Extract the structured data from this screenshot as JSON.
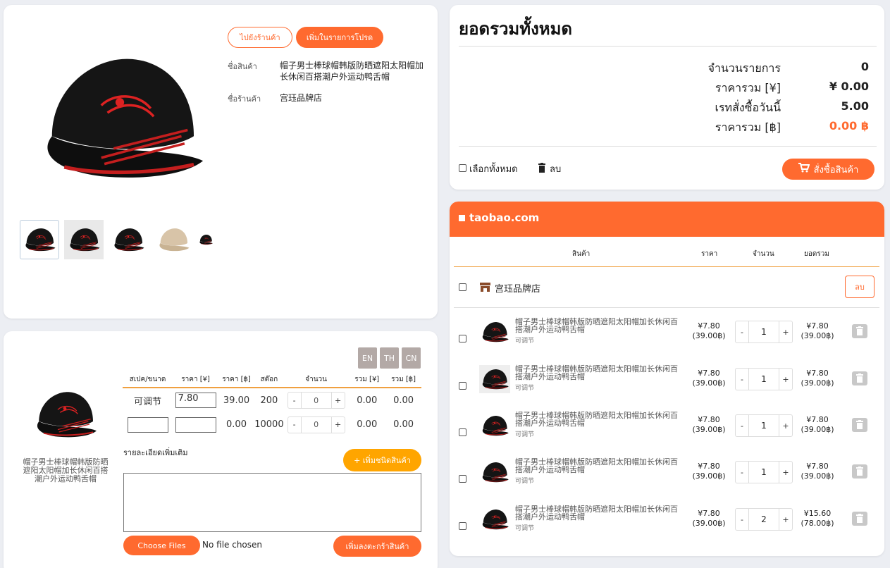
{
  "product": {
    "go_shop_label": "ไปยังร้านค้า",
    "add_fav_label": "เพิ่มในรายการโปรด",
    "name_label": "ชื่อสินค้า",
    "name_value": "帽子男士棒球帽韩版防晒遮阳太阳帽加长休闲百搭潮户外运动鸭舌帽",
    "shop_label": "ชื่อร้านค้า",
    "shop_value": "宫珏品牌店"
  },
  "spec": {
    "lang_buttons": [
      "EN",
      "TH",
      "CN"
    ],
    "headers": [
      "สเปค/ขนาด",
      "ราคา [¥]",
      "ราคา [฿]",
      "สต๊อก",
      "จำนวน",
      "รวม [¥]",
      "รวม [฿]"
    ],
    "rows": [
      {
        "spec": "可调节",
        "price_yen": "7.80",
        "price_baht": "39.00",
        "stock": "200",
        "qty": "0",
        "total_yen": "0.00",
        "total_baht": "0.00"
      },
      {
        "spec": "",
        "price_yen": "",
        "price_baht": "0.00",
        "stock": "10000",
        "qty": "0",
        "total_yen": "0.00",
        "total_baht": "0.00"
      }
    ],
    "product_caption": "帽子男士棒球帽韩版防晒遮阳太阳帽加长休闲百搭潮户外运动鸭舌帽",
    "details_label": "รายละเอียดเพิ่มเติม",
    "add_variant_label": "+ เพิ่มชนิดสินค้า",
    "choose_files_label": "Choose Files",
    "no_file_label": "No file chosen",
    "add_to_cart_label": "เพิ่มลงตะกร้าสินค้า"
  },
  "summary": {
    "title": "ยอดรวมทั้งหมด",
    "rows": [
      {
        "label": "จำนวนรายการ",
        "value": "0"
      },
      {
        "label": "ราคารวม [¥]",
        "value": "¥ 0.00"
      },
      {
        "label": "เรทสั่งซื้อวันนี้",
        "value": "5.00"
      },
      {
        "label": "ราคารวม [฿]",
        "value": "0.00 ฿"
      }
    ],
    "select_all_label": "เลือกทั้งหมด",
    "delete_label": "ลบ",
    "order_label": "สั่งซื้อสินค้า",
    "accent": "#ff6a2f"
  },
  "cart": {
    "site": "taobao.com",
    "headers": {
      "product": "สินค้า",
      "price": "ราคา",
      "qty": "จำนวน",
      "total": "ยอดรวม"
    },
    "shop_name": "宫珏品牌店",
    "shop_delete_label": "ลบ",
    "items": [
      {
        "name": "帽子男士棒球帽韩版防晒遮阳太阳帽加长休闲百搭潮户外运动鸭舌帽",
        "variant": "可调节",
        "price_yen": "¥7.80",
        "price_baht": "(39.00฿)",
        "qty": "1",
        "total_yen": "¥7.80",
        "total_baht": "(39.00฿)"
      },
      {
        "name": "帽子男士棒球帽韩版防晒遮阳太阳帽加长休闲百搭潮户外运动鸭舌帽",
        "variant": "可调节",
        "price_yen": "¥7.80",
        "price_baht": "(39.00฿)",
        "qty": "1",
        "total_yen": "¥7.80",
        "total_baht": "(39.00฿)"
      },
      {
        "name": "帽子男士棒球帽韩版防晒遮阳太阳帽加长休闲百搭潮户外运动鸭舌帽",
        "variant": "可调节",
        "price_yen": "¥7.80",
        "price_baht": "(39.00฿)",
        "qty": "1",
        "total_yen": "¥7.80",
        "total_baht": "(39.00฿)"
      },
      {
        "name": "帽子男士棒球帽韩版防晒遮阳太阳帽加长休闲百搭潮户外运动鸭舌帽",
        "variant": "可调节",
        "price_yen": "¥7.80",
        "price_baht": "(39.00฿)",
        "qty": "1",
        "total_yen": "¥7.80",
        "total_baht": "(39.00฿)"
      },
      {
        "name": "帽子男士棒球帽韩版防晒遮阳太阳帽加长休闲百搭潮户外运动鸭舌帽",
        "variant": "可调节",
        "price_yen": "¥7.80",
        "price_baht": "(39.00฿)",
        "qty": "2",
        "total_yen": "¥15.60",
        "total_baht": "(78.00฿)"
      }
    ]
  }
}
